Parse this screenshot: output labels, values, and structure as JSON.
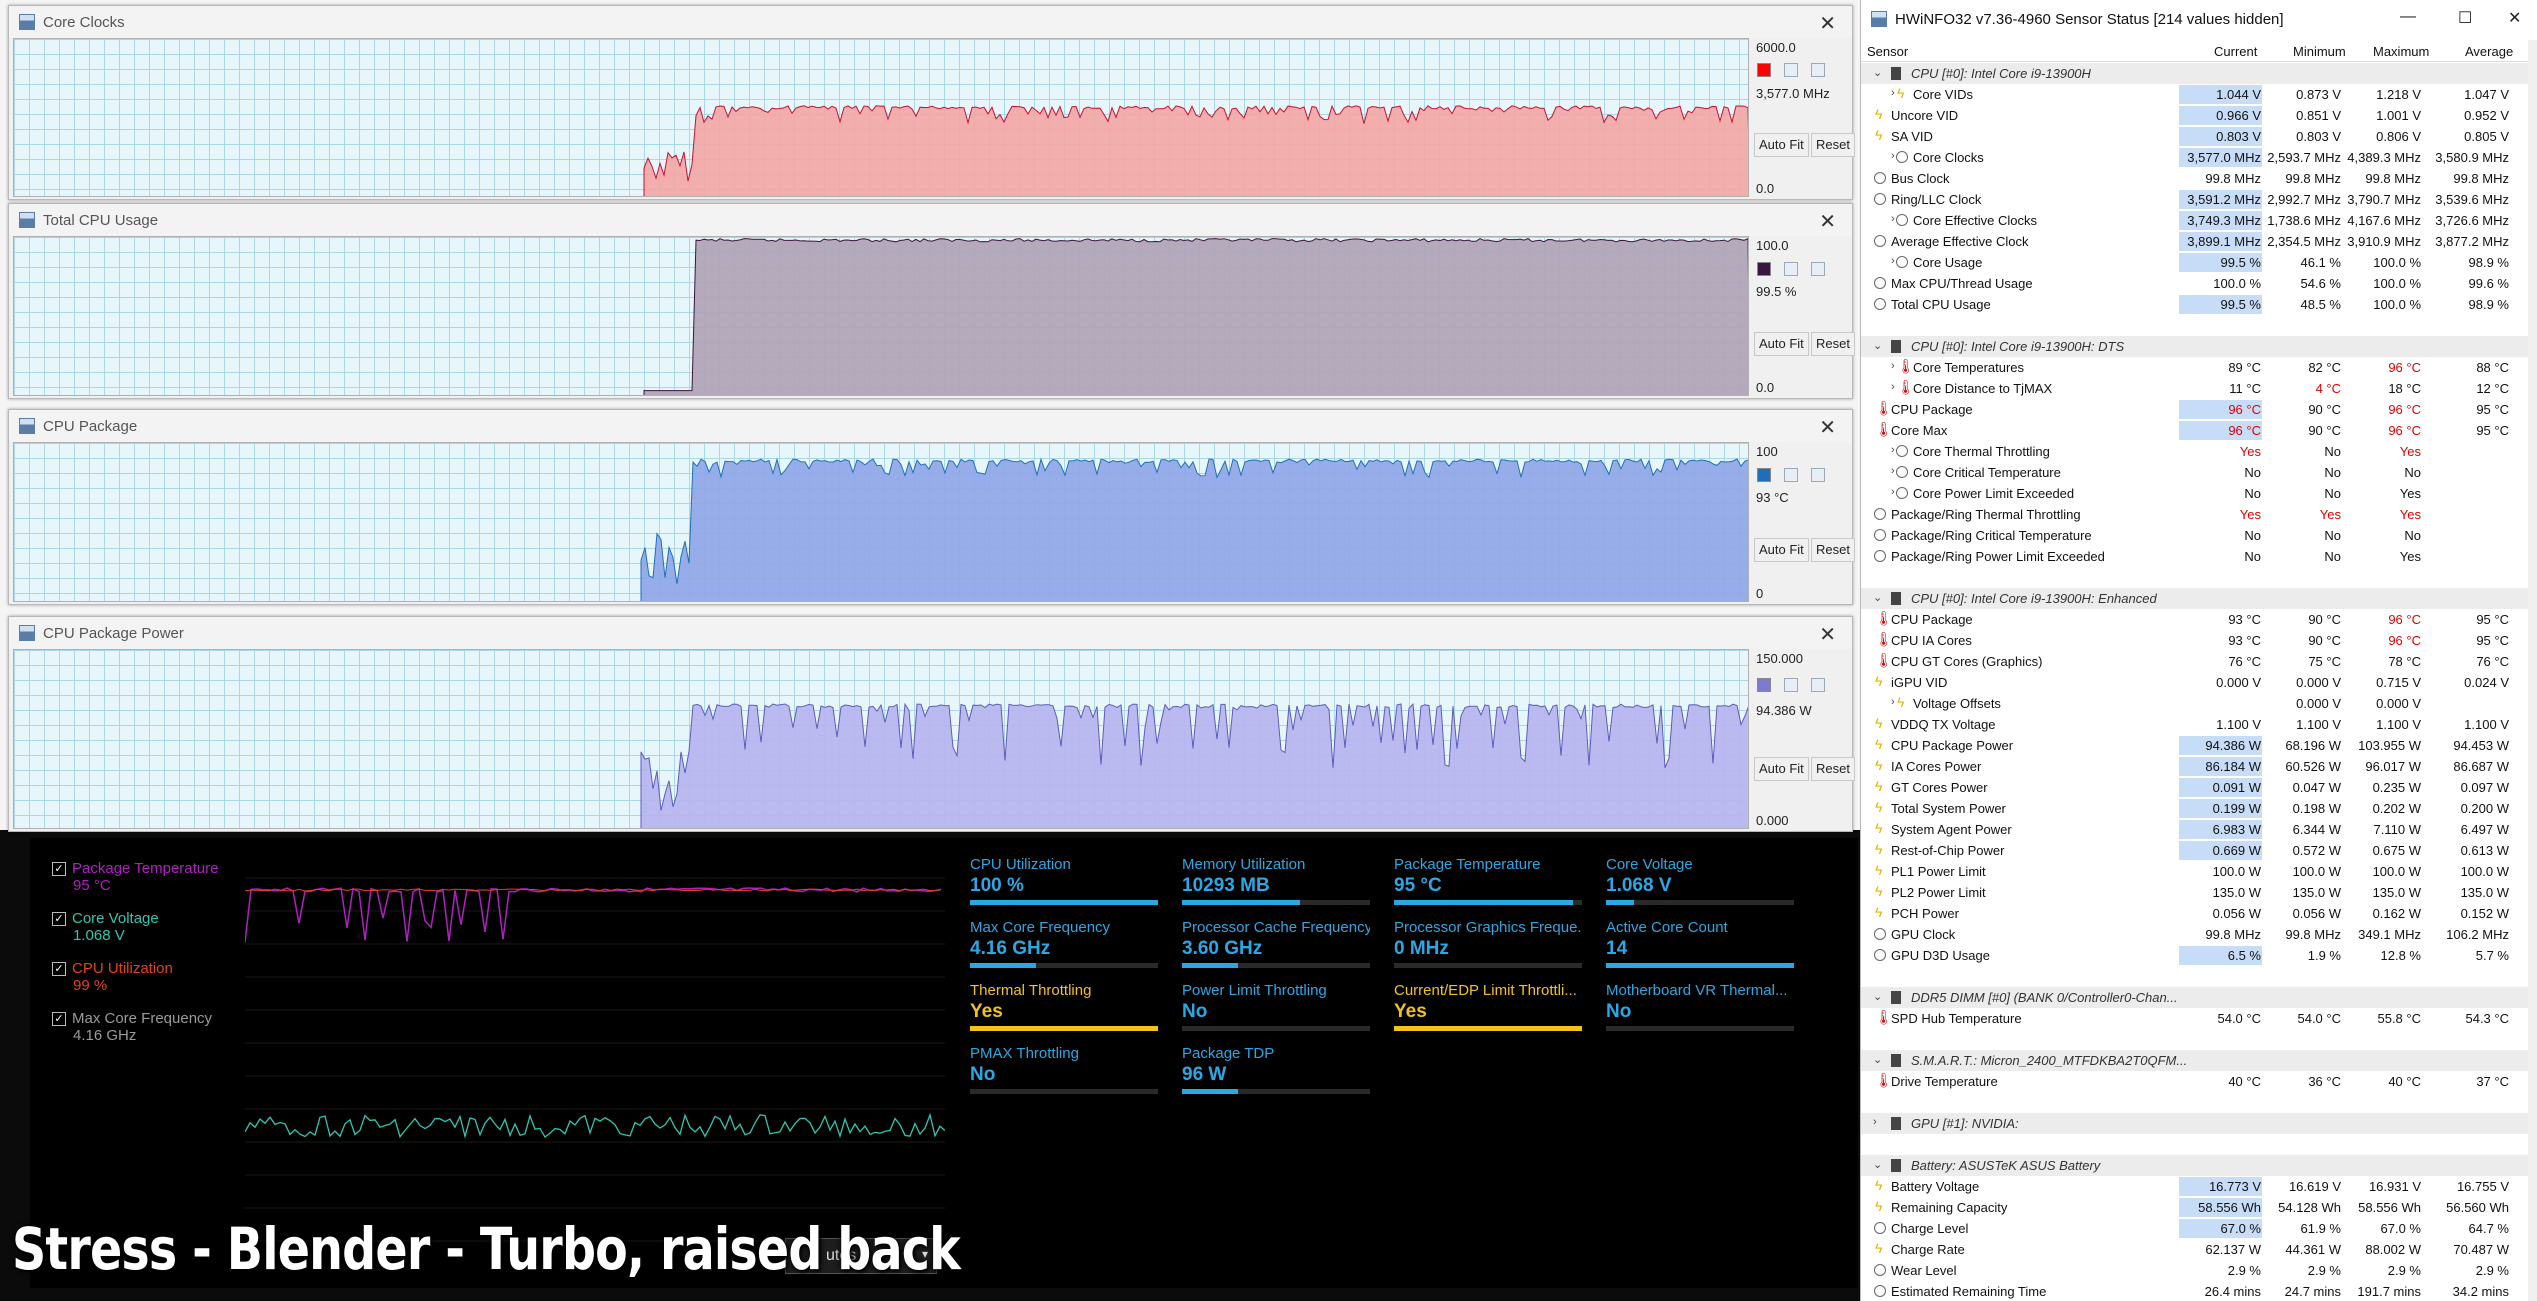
{
  "caption": "Stress - Blender - Turbo, raised back",
  "dropdown_fragment": "utes",
  "graphs": [
    {
      "title": "Core Clocks",
      "max": "6000.0",
      "current": "3,577.0 MHz",
      "min": "0.0",
      "color": "#ff0000",
      "fill": "#f3a6a6",
      "line": "#c8102e",
      "autofit": "Auto Fit",
      "reset": "Reset"
    },
    {
      "title": "Total CPU Usage",
      "max": "100.0",
      "current": "99.5 %",
      "min": "0.0",
      "color": "#3a1540",
      "fill": "#b0a3b6",
      "line": "#3a1540",
      "autofit": "Auto Fit",
      "reset": "Reset"
    },
    {
      "title": "CPU Package",
      "max": "100",
      "current": "93 °C",
      "min": "0",
      "color": "#1f6fb8",
      "fill": "#8fa6e8",
      "line": "#1f6fb8",
      "autofit": "Auto Fit",
      "reset": "Reset"
    },
    {
      "title": "CPU Package Power",
      "max": "150.000",
      "current": "94.386 W",
      "min": "0.000",
      "color": "#7b7bd0",
      "fill": "#b7b4ef",
      "line": "#5c5cb8",
      "autofit": "Auto Fit",
      "reset": "Reset"
    }
  ],
  "dashboard": {
    "sensors": [
      {
        "name": "Package Temperature",
        "value": "95 °C",
        "color": "#b020c0"
      },
      {
        "name": "Core Voltage",
        "value": "1.068 V",
        "color": "#2ec7b0"
      },
      {
        "name": "CPU Utilization",
        "value": "99 %",
        "color": "#e84018"
      },
      {
        "name": "Max Core Frequency",
        "value": "4.16 GHz",
        "color": "#9a9a9a"
      }
    ],
    "tiles": [
      {
        "label": "CPU Utilization",
        "value": "100 %",
        "fill": 1.0,
        "warn": false
      },
      {
        "label": "Memory Utilization",
        "value": "10293  MB",
        "fill": 0.63,
        "warn": false
      },
      {
        "label": "Package Temperature",
        "value": "95 °C",
        "fill": 0.95,
        "warn": false
      },
      {
        "label": "Core Voltage",
        "value": "1.068 V",
        "fill": 0.15,
        "warn": false
      },
      {
        "label": "Max Core Frequency",
        "value": "4.16 GHz",
        "fill": 0.35,
        "warn": false
      },
      {
        "label": "Processor Cache Frequency",
        "value": "3.60 GHz",
        "fill": 0.3,
        "warn": false
      },
      {
        "label": "Processor Graphics Freque...",
        "value": "0 MHz",
        "fill": 0.0,
        "warn": false
      },
      {
        "label": "Active Core Count",
        "value": "14",
        "fill": 1.0,
        "warn": false
      },
      {
        "label": "Thermal Throttling",
        "value": "Yes",
        "fill": 1.0,
        "warn": true
      },
      {
        "label": "Power Limit Throttling",
        "value": "No",
        "fill": 0.0,
        "warn": false
      },
      {
        "label": "Current/EDP Limit Throttli...",
        "value": "Yes",
        "fill": 1.0,
        "warn": true
      },
      {
        "label": "Motherboard VR Thermal...",
        "value": "No",
        "fill": 0.0,
        "warn": false
      },
      {
        "label": "PMAX Throttling",
        "value": "No",
        "fill": 0.0,
        "warn": false
      },
      {
        "label": "Package TDP",
        "value": "96 W",
        "fill": 0.3,
        "warn": false
      }
    ]
  },
  "hwinfo": {
    "title": "HWiNFO32 v7.36-4960 Sensor Status [214 values hidden]",
    "columns": [
      "Sensor",
      "Current",
      "Minimum",
      "Maximum",
      "Average"
    ],
    "rows": [
      {
        "g": 1,
        "label": "CPU [#0]: Intel Core i9-13900H"
      },
      {
        "label": "Core VIDs",
        "icon": "volt",
        "exp": 1,
        "v": [
          "1.044 V",
          "0.873 V",
          "1.218 V",
          "1.047 V"
        ],
        "hl": 1
      },
      {
        "label": "Uncore VID",
        "icon": "volt",
        "v": [
          "0.966 V",
          "0.851 V",
          "1.001 V",
          "0.952 V"
        ],
        "hl": 1
      },
      {
        "label": "SA VID",
        "icon": "volt",
        "v": [
          "0.803 V",
          "0.803 V",
          "0.806 V",
          "0.805 V"
        ],
        "hl": 1
      },
      {
        "label": "Core Clocks",
        "icon": "clock",
        "exp": 1,
        "v": [
          "3,577.0 MHz",
          "2,593.7 MHz",
          "4,389.3 MHz",
          "3,580.9 MHz"
        ],
        "hl": 1
      },
      {
        "label": "Bus Clock",
        "icon": "clock",
        "v": [
          "99.8 MHz",
          "99.8 MHz",
          "99.8 MHz",
          "99.8 MHz"
        ]
      },
      {
        "label": "Ring/LLC Clock",
        "icon": "clock",
        "v": [
          "3,591.2 MHz",
          "2,992.7 MHz",
          "3,790.7 MHz",
          "3,539.6 MHz"
        ],
        "hl": 1
      },
      {
        "label": "Core Effective Clocks",
        "icon": "clock",
        "exp": 1,
        "v": [
          "3,749.3 MHz",
          "1,738.6 MHz",
          "4,167.6 MHz",
          "3,726.6 MHz"
        ],
        "hl": 1
      },
      {
        "label": "Average Effective Clock",
        "icon": "clock",
        "v": [
          "3,899.1 MHz",
          "2,354.5 MHz",
          "3,910.9 MHz",
          "3,877.2 MHz"
        ],
        "hl": 1
      },
      {
        "label": "Core Usage",
        "icon": "clock",
        "exp": 1,
        "v": [
          "99.5 %",
          "46.1 %",
          "100.0 %",
          "98.9 %"
        ],
        "hl": 1
      },
      {
        "label": "Max CPU/Thread Usage",
        "icon": "clock",
        "v": [
          "100.0 %",
          "54.6 %",
          "100.0 %",
          "99.6 %"
        ]
      },
      {
        "label": "Total CPU Usage",
        "icon": "clock",
        "v": [
          "99.5 %",
          "48.5 %",
          "100.0 %",
          "98.9 %"
        ],
        "hl": 1
      },
      {
        "blank": 1
      },
      {
        "g": 1,
        "label": "CPU [#0]: Intel Core i9-13900H: DTS"
      },
      {
        "label": "Core Temperatures",
        "icon": "temp",
        "exp": 1,
        "v": [
          "89 °C",
          "82 °C",
          "96 °C",
          "88 °C"
        ],
        "red": [
          2
        ]
      },
      {
        "label": "Core Distance to TjMAX",
        "icon": "temp",
        "exp": 1,
        "v": [
          "11 °C",
          "4 °C",
          "18 °C",
          "12 °C"
        ],
        "red": [
          1
        ]
      },
      {
        "label": "CPU Package",
        "icon": "temp",
        "v": [
          "96 °C",
          "90 °C",
          "96 °C",
          "95 °C"
        ],
        "red": [
          0,
          2
        ],
        "hl": 1
      },
      {
        "label": "Core Max",
        "icon": "temp",
        "v": [
          "96 °C",
          "90 °C",
          "96 °C",
          "95 °C"
        ],
        "red": [
          0,
          2
        ],
        "hl": 1
      },
      {
        "label": "Core Thermal Throttling",
        "icon": "clock",
        "exp": 1,
        "v": [
          "Yes",
          "No",
          "Yes",
          ""
        ],
        "red": [
          0,
          2
        ]
      },
      {
        "label": "Core Critical Temperature",
        "icon": "clock",
        "exp": 1,
        "v": [
          "No",
          "No",
          "No",
          ""
        ]
      },
      {
        "label": "Core Power Limit Exceeded",
        "icon": "clock",
        "exp": 1,
        "v": [
          "No",
          "No",
          "Yes",
          ""
        ]
      },
      {
        "label": "Package/Ring Thermal Throttling",
        "icon": "clock",
        "v": [
          "Yes",
          "Yes",
          "Yes",
          ""
        ],
        "red": [
          0,
          1,
          2
        ]
      },
      {
        "label": "Package/Ring Critical Temperature",
        "icon": "clock",
        "v": [
          "No",
          "No",
          "No",
          ""
        ]
      },
      {
        "label": "Package/Ring Power Limit Exceeded",
        "icon": "clock",
        "v": [
          "No",
          "No",
          "Yes",
          ""
        ]
      },
      {
        "blank": 1
      },
      {
        "g": 1,
        "label": "CPU [#0]: Intel Core i9-13900H: Enhanced"
      },
      {
        "label": "CPU Package",
        "icon": "temp",
        "v": [
          "93 °C",
          "90 °C",
          "96 °C",
          "95 °C"
        ],
        "red": [
          2
        ]
      },
      {
        "label": "CPU IA Cores",
        "icon": "temp",
        "v": [
          "93 °C",
          "90 °C",
          "96 °C",
          "95 °C"
        ],
        "red": [
          2
        ]
      },
      {
        "label": "CPU GT Cores (Graphics)",
        "icon": "temp",
        "v": [
          "76 °C",
          "75 °C",
          "78 °C",
          "76 °C"
        ]
      },
      {
        "label": "iGPU VID",
        "icon": "volt",
        "v": [
          "0.000 V",
          "0.000 V",
          "0.715 V",
          "0.024 V"
        ]
      },
      {
        "label": "Voltage Offsets",
        "icon": "volt",
        "exp": 1,
        "v": [
          "",
          "0.000 V",
          "0.000 V",
          ""
        ]
      },
      {
        "label": "VDDQ TX Voltage",
        "icon": "volt",
        "v": [
          "1.100 V",
          "1.100 V",
          "1.100 V",
          "1.100 V"
        ]
      },
      {
        "label": "CPU Package Power",
        "icon": "volt",
        "v": [
          "94.386 W",
          "68.196 W",
          "103.955 W",
          "94.453 W"
        ],
        "hl": 1
      },
      {
        "label": "IA Cores Power",
        "icon": "volt",
        "v": [
          "86.184 W",
          "60.526 W",
          "96.017 W",
          "86.687 W"
        ],
        "hl": 1
      },
      {
        "label": "GT Cores Power",
        "icon": "volt",
        "v": [
          "0.091 W",
          "0.047 W",
          "0.235 W",
          "0.097 W"
        ],
        "hl": 1
      },
      {
        "label": "Total System Power",
        "icon": "volt",
        "v": [
          "0.199 W",
          "0.198 W",
          "0.202 W",
          "0.200 W"
        ],
        "hl": 1
      },
      {
        "label": "System Agent Power",
        "icon": "volt",
        "v": [
          "6.983 W",
          "6.344 W",
          "7.110 W",
          "6.497 W"
        ],
        "hl": 1
      },
      {
        "label": "Rest-of-Chip Power",
        "icon": "volt",
        "v": [
          "0.669 W",
          "0.572 W",
          "0.675 W",
          "0.613 W"
        ],
        "hl": 1
      },
      {
        "label": "PL1 Power Limit",
        "icon": "volt",
        "v": [
          "100.0 W",
          "100.0 W",
          "100.0 W",
          "100.0 W"
        ]
      },
      {
        "label": "PL2 Power Limit",
        "icon": "volt",
        "v": [
          "135.0 W",
          "135.0 W",
          "135.0 W",
          "135.0 W"
        ]
      },
      {
        "label": "PCH Power",
        "icon": "volt",
        "v": [
          "0.056 W",
          "0.056 W",
          "0.162 W",
          "0.152 W"
        ]
      },
      {
        "label": "GPU Clock",
        "icon": "clock",
        "v": [
          "99.8 MHz",
          "99.8 MHz",
          "349.1 MHz",
          "106.2 MHz"
        ]
      },
      {
        "label": "GPU D3D Usage",
        "icon": "clock",
        "v": [
          "6.5 %",
          "1.9 %",
          "12.8 %",
          "5.7 %"
        ],
        "hl": 1
      },
      {
        "blank": 1
      },
      {
        "g": 1,
        "label": "DDR5 DIMM [#0] (BANK 0/Controller0-Chan..."
      },
      {
        "label": "SPD Hub Temperature",
        "icon": "temp",
        "v": [
          "54.0 °C",
          "54.0 °C",
          "55.8 °C",
          "54.3 °C"
        ]
      },
      {
        "blank": 1
      },
      {
        "g": 1,
        "label": "S.M.A.R.T.: Micron_2400_MTFDKBA2T0QFM..."
      },
      {
        "label": "Drive Temperature",
        "icon": "temp",
        "v": [
          "40 °C",
          "36 °C",
          "40 °C",
          "37 °C"
        ]
      },
      {
        "blank": 1
      },
      {
        "g": 1,
        "label": "GPU [#1]: NVIDIA:",
        "collapsed": 1
      },
      {
        "blank": 1
      },
      {
        "g": 1,
        "label": "Battery: ASUSTeK ASUS Battery"
      },
      {
        "label": "Battery Voltage",
        "icon": "volt",
        "v": [
          "16.773 V",
          "16.619 V",
          "16.931 V",
          "16.755 V"
        ],
        "hl": 1
      },
      {
        "label": "Remaining Capacity",
        "icon": "volt",
        "v": [
          "58.556 Wh",
          "54.128 Wh",
          "58.556 Wh",
          "56.560 Wh"
        ],
        "hl": 1
      },
      {
        "label": "Charge Level",
        "icon": "clock",
        "v": [
          "67.0 %",
          "61.9 %",
          "67.0 %",
          "64.7 %"
        ],
        "hl": 1
      },
      {
        "label": "Charge Rate",
        "icon": "volt",
        "v": [
          "62.137 W",
          "44.361 W",
          "88.002 W",
          "70.487 W"
        ]
      },
      {
        "label": "Wear Level",
        "icon": "clock",
        "v": [
          "2.9 %",
          "2.9 %",
          "2.9 %",
          "2.9 %"
        ]
      },
      {
        "label": "Estimated Remaining Time",
        "icon": "clock",
        "v": [
          "26.4 mins",
          "24.7 mins",
          "191.7 mins",
          "34.2 mins"
        ]
      }
    ]
  }
}
